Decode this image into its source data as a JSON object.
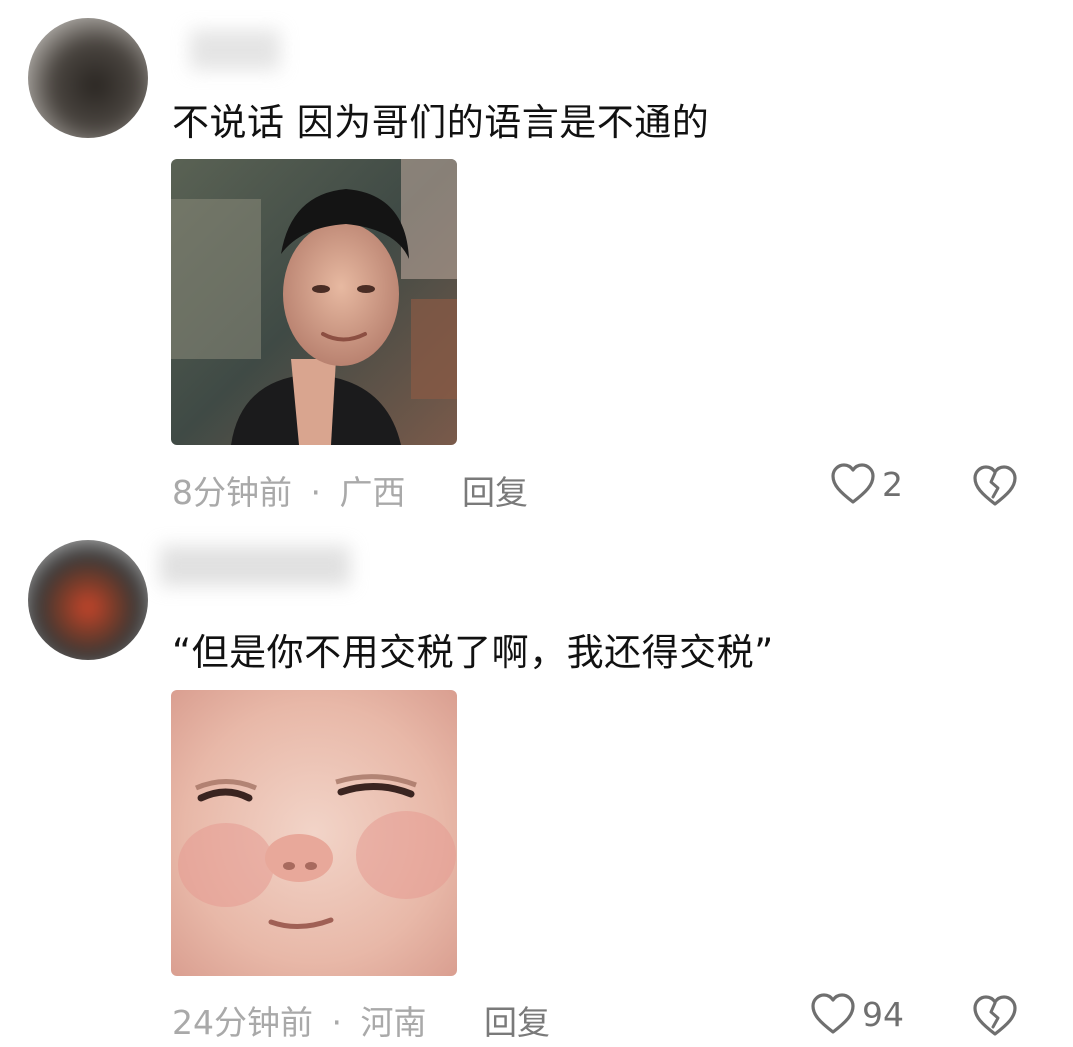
{
  "comments": [
    {
      "text": "不说话 因为哥们的语言是不通的",
      "time": "8分钟前",
      "separator": "·",
      "location": "广西",
      "reply_label": "回复",
      "like_count": "2",
      "like_icon": "heart-outline-icon",
      "dislike_icon": "broken-heart-icon"
    },
    {
      "text": "“但是你不用交税了啊，我还得交税”",
      "time": "24分钟前",
      "separator": "·",
      "location": "河南",
      "reply_label": "回复",
      "like_count": "94",
      "like_icon": "heart-outline-icon",
      "dislike_icon": "broken-heart-icon"
    }
  ],
  "colors": {
    "text_primary": "#111111",
    "text_meta": "#a9a9a9",
    "text_action": "#7a7a7a",
    "icon": "#6f6f6f"
  }
}
